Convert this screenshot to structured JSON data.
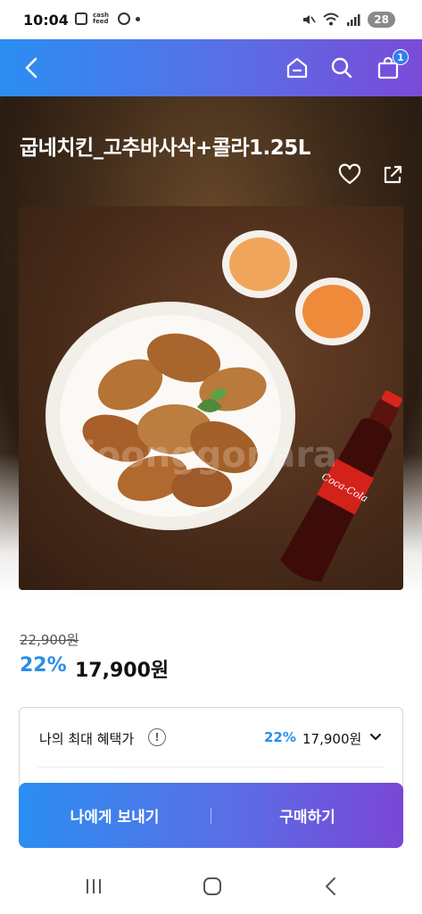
{
  "status_bar": {
    "time": "10:04",
    "cashfeed_label": "cash feed",
    "battery": "28"
  },
  "header": {
    "back_icon": "chevron-left-icon",
    "home_icon": "home-icon",
    "search_icon": "search-icon",
    "cart_icon": "shopping-bag-icon",
    "cart_count": "1"
  },
  "product": {
    "title": "굽네치킨_고추바사삭+콜라1.25L",
    "like_icon": "heart-icon",
    "share_icon": "share-icon",
    "image_watermark": "joonggonara"
  },
  "price": {
    "original": "22,900원",
    "discount_rate": "22%",
    "sale": "17,900원"
  },
  "benefit": {
    "label": "나의 최대 혜택가",
    "info_symbol": "!",
    "rate": "22%",
    "price": "17,900원"
  },
  "cta": {
    "send_label": "나에게 보내기",
    "buy_label": "구매하기"
  },
  "colors": {
    "accent_blue": "#2a8ee8",
    "gradient_start": "#2b8ef2",
    "gradient_end": "#7a46d6"
  }
}
